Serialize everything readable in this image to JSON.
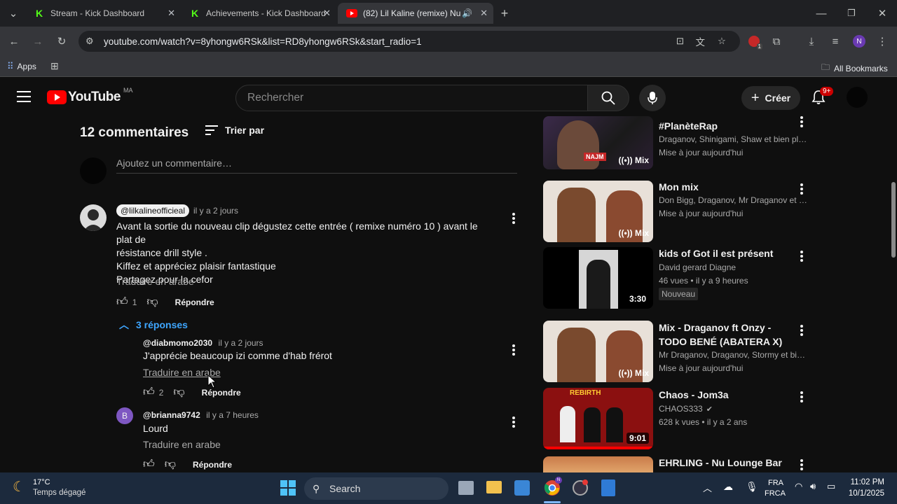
{
  "browser": {
    "tabs": [
      {
        "title": "Stream - Kick Dashboard",
        "icon": "kick-icon"
      },
      {
        "title": "Achievements - Kick Dashboard",
        "icon": "kick-icon"
      },
      {
        "title": "(82) Lil Kaline (remixe) Num",
        "icon": "youtube-icon"
      }
    ],
    "url": "youtube.com/watch?v=8yhongw6RSk&list=RD8yhongw6RSk&start_radio=1",
    "bookmarks": {
      "apps": "Apps",
      "all": "All Bookmarks"
    },
    "profile_initial": "N",
    "extension_badge": "1"
  },
  "youtube": {
    "logo": "YouTube",
    "region": "MA",
    "search_placeholder": "Rechercher",
    "create_label": "Créer",
    "notif_count": "9+"
  },
  "comments": {
    "count_label": "12 commentaires",
    "sort_label": "Trier par",
    "add_placeholder": "Ajoutez un commentaire…",
    "items": [
      {
        "author": "@lilkalineofficieal",
        "time": "il y a 2 jours",
        "lines": [
          "Avant la sortie du nouveau clip dégustez cette entrée ( remixe numéro 10 ) avant le plat de",
          "résistance drill style .",
          "Kiffez et appréciez plaisir fantastique",
          "Partagez pour la cefor"
        ],
        "translate": "Traduire en arabe",
        "likes": "1",
        "reply": "Répondre",
        "replies_toggle": "3 réponses"
      },
      {
        "author": "@diabmomo2030",
        "time": "il y a 2 jours",
        "text": "J'apprécie beaucoup izi comme d'hab frérot",
        "translate": "Traduire en arabe",
        "likes": "2",
        "reply": "Répondre"
      },
      {
        "author": "@brianna9742",
        "time": "il y a 7 heures",
        "avatar_letter": "B",
        "text": "Lourd",
        "translate": "Traduire en arabe",
        "reply": "Répondre"
      }
    ]
  },
  "sidebar_videos": [
    {
      "title": "#PlanèteRap",
      "line1": "Draganov, Shinigami, Shaw et bien plus e...",
      "line2": "Mise à jour aujourd'hui",
      "badge": "Mix",
      "thumb_text": "NAJM"
    },
    {
      "title": "Mon mix",
      "line1": "Don Bigg, Draganov, Mr Draganov et bien...",
      "line2": "Mise à jour aujourd'hui",
      "badge": "Mix"
    },
    {
      "title": "kids of Got il est présent",
      "line1": "David gerard Diagne",
      "line2": "46 vues • il y a 9 heures",
      "badge": "3:30",
      "tag": "Nouveau"
    },
    {
      "title": "Mix - Draganov ft Onzy - TODO BENÉ (ABATERA X)",
      "line1": "Mr Draganov, Draganov, Stormy et bien pl...",
      "line2": "Mise à jour aujourd'hui",
      "badge": "Mix"
    },
    {
      "title": "Chaos - Jom3a",
      "line1": "CHAOS333",
      "line2": "628 k vues • il y a 2 ans",
      "badge": "9:01",
      "thumb_text": "REBIRTH"
    },
    {
      "title": "EHRLING - Nu Lounge Bar",
      "line1": "",
      "line2": ""
    }
  ],
  "taskbar": {
    "weather_temp": "17°C",
    "weather_desc": "Temps dégagé",
    "search_label": "Search",
    "lang1": "FRA",
    "lang2": "FRCA",
    "time": "11:02 PM",
    "date": "10/1/2025"
  },
  "colors": {
    "youtube_red": "#ff0000",
    "kick_green": "#53fc18",
    "taskbar": "#1c2a3d"
  }
}
